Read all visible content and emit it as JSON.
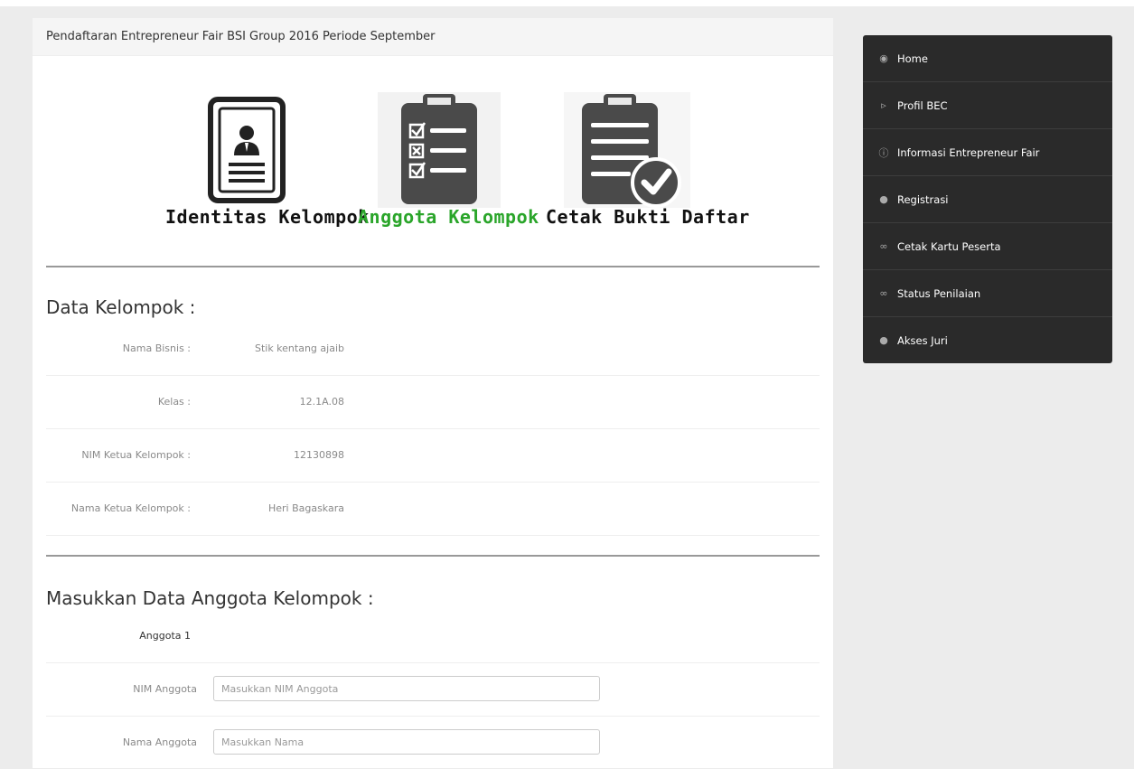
{
  "panel": {
    "title": "Pendaftaran Entrepreneur Fair BSI Group 2016 Periode September"
  },
  "steps": [
    {
      "label": "Identitas Kelompok",
      "icon": "id-card-icon",
      "active": false
    },
    {
      "label": "Anggota Kelompok",
      "icon": "checklist-icon",
      "active": true
    },
    {
      "label": "Cetak Bukti Daftar",
      "icon": "print-proof-icon",
      "active": false
    }
  ],
  "data_kelompok": {
    "title": "Data Kelompok :",
    "rows": [
      {
        "label": "Nama Bisnis :",
        "value": "Stik kentang ajaib"
      },
      {
        "label": "Kelas :",
        "value": "12.1A.08"
      },
      {
        "label": "NIM Ketua Kelompok :",
        "value": "12130898"
      },
      {
        "label": "Nama Ketua Kelompok :",
        "value": "Heri Bagaskara"
      }
    ]
  },
  "anggota": {
    "title": "Masukkan Data Anggota Kelompok :",
    "header": "Anggota 1",
    "fields": [
      {
        "label": "NIM Anggota",
        "placeholder": "Masukkan NIM Anggota",
        "value": ""
      },
      {
        "label": "Nama Anggota",
        "placeholder": "Masukkan Nama",
        "value": ""
      }
    ]
  },
  "sidebar": {
    "items": [
      {
        "label": "Home",
        "icon": "dashboard-icon"
      },
      {
        "label": "Profil BEC",
        "icon": "bullhorn-icon"
      },
      {
        "label": "Informasi Entrepreneur Fair",
        "icon": "info-icon"
      },
      {
        "label": "Registrasi",
        "icon": "user-icon"
      },
      {
        "label": "Cetak Kartu Peserta",
        "icon": "link-icon"
      },
      {
        "label": "Status Penilaian",
        "icon": "link-icon"
      },
      {
        "label": "Akses Juri",
        "icon": "user-icon"
      }
    ]
  },
  "colors": {
    "active_step": "#2aa52a",
    "sidebar_bg": "#2a2a2a",
    "page_bg": "#ececec"
  }
}
